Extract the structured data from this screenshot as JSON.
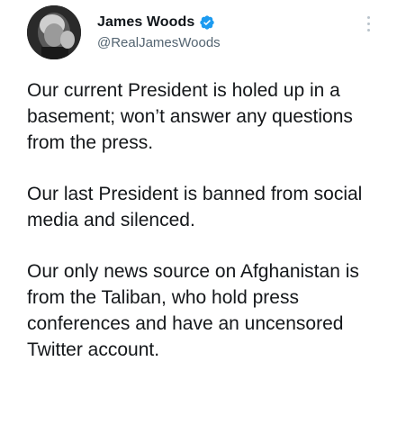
{
  "user": {
    "display_name": "James Woods",
    "handle": "@RealJamesWoods",
    "verified": true,
    "verified_color": "#1d9bf0"
  },
  "menu_icon": "more-vertical-icon",
  "tweet": {
    "paragraphs": [
      "Our current President is holed up in a basement; won’t answer any questions from the press.",
      "Our last President is banned from social media and silenced.",
      "Our only news source on Afghanistan is from the Taliban, who hold press conferences and have an uncensored Twitter account."
    ]
  }
}
